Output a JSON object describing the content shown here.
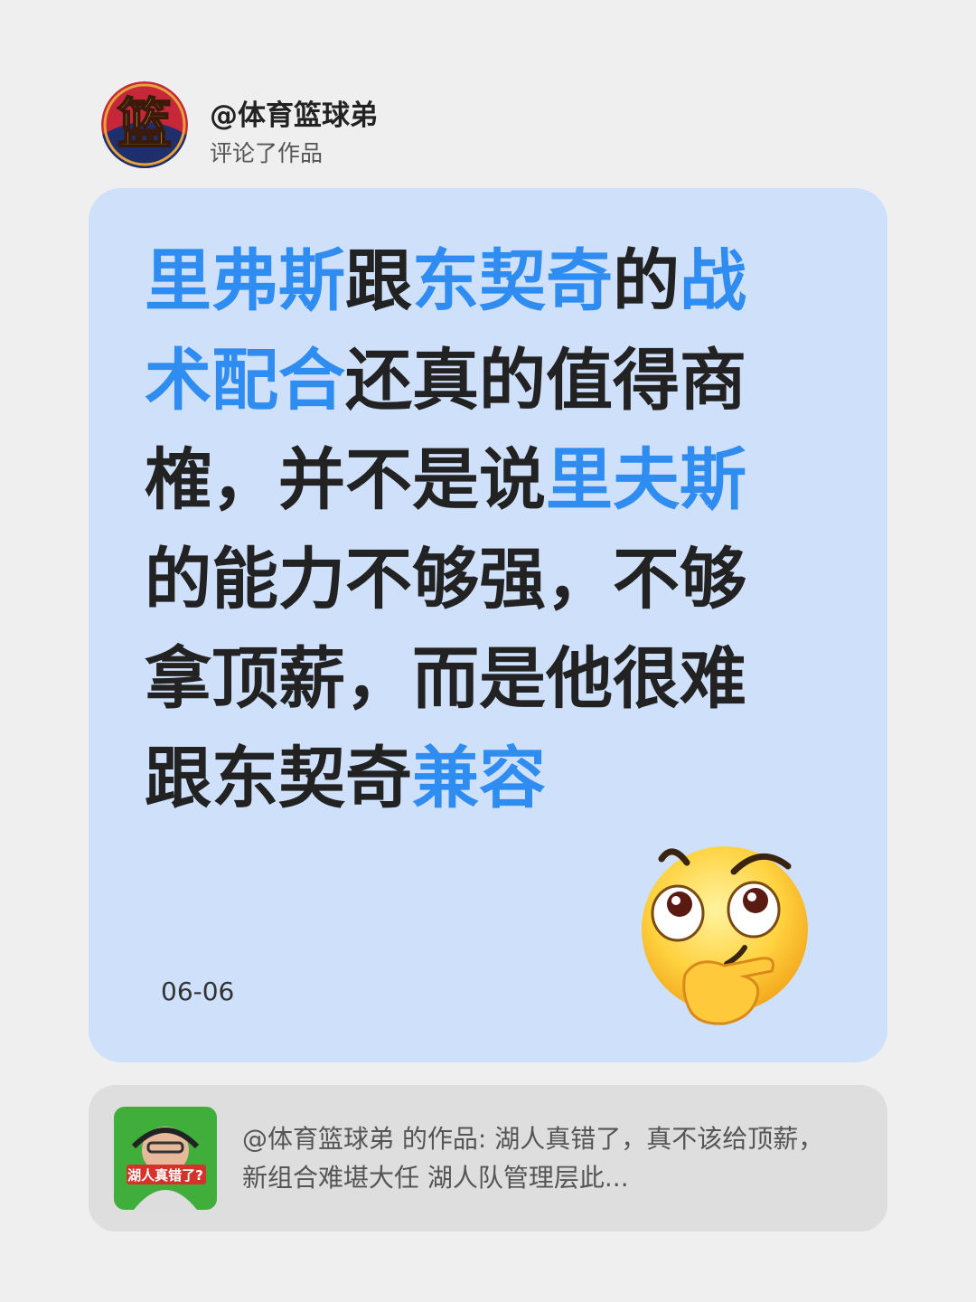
{
  "header": {
    "username": "@体育篮球弟",
    "subtitle": "评论了作品",
    "avatar_glyph": "篮",
    "avatar_icon": "basketball-logo-icon"
  },
  "comment": {
    "segments": [
      {
        "text": "里弗斯",
        "highlight": true
      },
      {
        "text": "跟",
        "highlight": false
      },
      {
        "text": "东契奇",
        "highlight": true
      },
      {
        "text": "的",
        "highlight": false
      },
      {
        "text": "战术配合",
        "highlight": true
      },
      {
        "text": "还真的值得商榷，并不是说",
        "highlight": false
      },
      {
        "text": "里夫斯",
        "highlight": true
      },
      {
        "text": "的能力不够强，不够拿顶薪，而是他很难跟东契奇",
        "highlight": false
      },
      {
        "text": "兼容",
        "highlight": true
      }
    ],
    "date": "06-06",
    "emoji": "thinking-face-emoji"
  },
  "work": {
    "thumbnail_caption": "湖人真错了?",
    "text": "@体育篮球弟  的作品: 湖人真错了，真不该给顶薪，新组合难堪大任 湖人队管理层此..."
  },
  "colors": {
    "background": "#efefef",
    "card": "#cfe0fb",
    "highlight": "#2f8cf0",
    "text": "#222222",
    "work_card": "#dedede"
  }
}
